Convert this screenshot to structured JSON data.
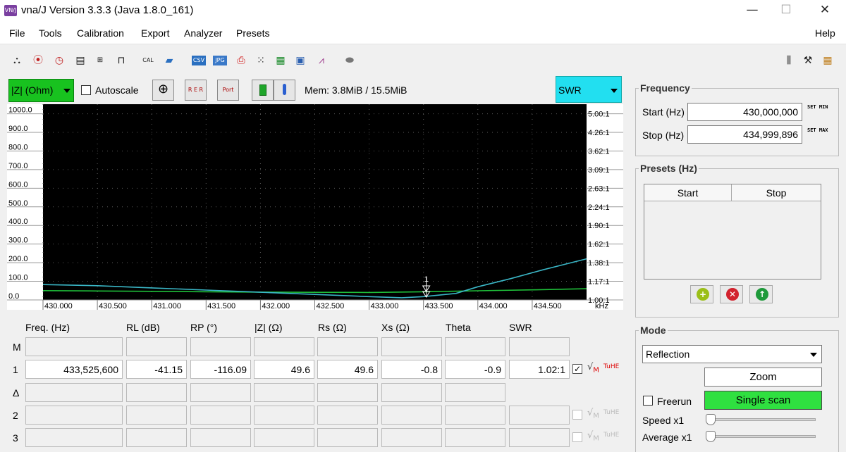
{
  "window": {
    "title": "vna/J Version 3.3.3 (Java 1.8.0_161)",
    "app_icon": "VN/J",
    "minimize": "—",
    "maximize": "☐",
    "close": "✕"
  },
  "menu": {
    "file": "File",
    "tools": "Tools",
    "calibration": "Calibration",
    "export": "Export",
    "analyzer": "Analyzer",
    "presets": "Presets",
    "help": "Help"
  },
  "toolbar_icons": [
    "analyzer-icon",
    "antenna-icon",
    "clock-icon",
    "calibration-file-icon",
    "cal-table-icon",
    "probe-icon",
    "cal-icon",
    "open-folder-icon",
    "csv-export-icon",
    "image-export-icon",
    "pdf-export-icon",
    "scatter-export-icon",
    "excel-export-icon",
    "print-icon",
    "chart-export-icon",
    "eraser-icon",
    "tools-pin-icon",
    "wrench-icon",
    "grid-settings-icon"
  ],
  "diagram": {
    "left_scale": "|Z| (Ohm)",
    "autoscale_label": "Autoscale",
    "autoscale_checked": false,
    "memory": "Mem: 3.8MiB / 15.5MiB",
    "right_scale": "SWR",
    "cal_btn_label": "R E R",
    "port_btn_label": "Port Ext."
  },
  "chart_data": {
    "type": "line",
    "background": "#000000",
    "xlabel": "kHz",
    "x_ticks": [
      "430.000",
      "430.500",
      "431.000",
      "431.500",
      "432.000",
      "432.500",
      "433.000",
      "433.500",
      "434.000",
      "434.500"
    ],
    "xlim": [
      430.0,
      435.0
    ],
    "y_left_ticks": [
      "1000.0",
      "900.0",
      "800.0",
      "700.0",
      "600.0",
      "500.0",
      "400.0",
      "300.0",
      "200.0",
      "100.0",
      "0.0"
    ],
    "y_left_values": [
      1000,
      900,
      800,
      700,
      600,
      500,
      400,
      300,
      200,
      100,
      0
    ],
    "ylim_left": [
      0,
      1000
    ],
    "y_right_ticks": [
      "5.00:1",
      "4.26:1",
      "3.62:1",
      "3.09:1",
      "2.63:1",
      "2.24:1",
      "1.90:1",
      "1.62:1",
      "1.38:1",
      "1.17:1",
      "1.00:1"
    ],
    "y_right_values": [
      5.0,
      4.26,
      3.62,
      3.09,
      2.63,
      2.24,
      1.9,
      1.62,
      1.38,
      1.17,
      1.0
    ],
    "ylim_right": [
      1.0,
      5.0
    ],
    "grid": true,
    "series": [
      {
        "color": "#1fbf3a",
        "axis": "left",
        "x": [
          430.0,
          430.5,
          431.0,
          431.5,
          432.0,
          432.5,
          433.0,
          433.5,
          434.0,
          434.5,
          435.0
        ],
        "y": [
          50,
          48,
          46,
          44,
          42,
          41,
          40,
          44,
          49,
          54,
          60
        ]
      },
      {
        "color": "#3ab6c6",
        "axis": "right",
        "x": [
          430.0,
          430.5,
          431.0,
          431.5,
          432.0,
          432.5,
          433.0,
          433.3,
          433.5,
          433.8,
          434.0,
          434.3,
          434.6,
          435.0
        ],
        "y": [
          1.14,
          1.13,
          1.11,
          1.09,
          1.07,
          1.05,
          1.03,
          1.02,
          1.03,
          1.06,
          1.12,
          1.2,
          1.3,
          1.43
        ]
      }
    ],
    "marker": {
      "label": "1",
      "x": 433.5256
    }
  },
  "frequency": {
    "title": "Frequency",
    "start_label": "Start (Hz)",
    "start_value": "430,000,000",
    "stop_label": "Stop (Hz)",
    "stop_value": "434,999,896",
    "set_min": "SET MIN",
    "set_max": "SET MAX"
  },
  "presets": {
    "title": "Presets (Hz)",
    "col_start": "Start",
    "col_stop": "Stop"
  },
  "mode": {
    "title": "Mode",
    "selected": "Reflection",
    "zoom_label": "Zoom",
    "freerun_label": "Freerun",
    "freerun_checked": false,
    "single_scan_label": "Single scan",
    "speed_label": "Speed x1",
    "average_label": "Average x1"
  },
  "markers": {
    "headers": [
      "Freq. (Hz)",
      "RL (dB)",
      "RP (°)",
      "|Z| (Ω)",
      "Rs (Ω)",
      "Xs (Ω)",
      "Theta",
      "SWR"
    ],
    "row_labels": [
      "M",
      "1",
      "Δ",
      "2",
      "3"
    ],
    "row1": [
      "433,525,600",
      "-41.15",
      "-116.09",
      "49.6",
      "49.6",
      "-0.8",
      "-0.9",
      "1.02:1"
    ],
    "row1_checked": true,
    "sqrt_icon": "√",
    "sqrt_sub": "M",
    "the_icon": "TuHE"
  }
}
